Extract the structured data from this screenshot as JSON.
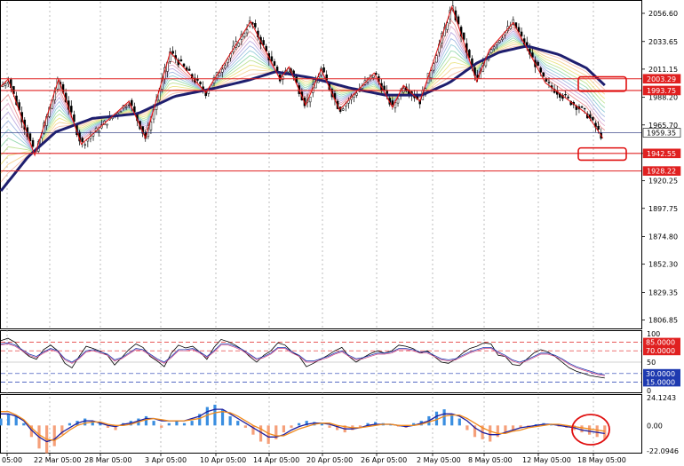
{
  "chart_data": [
    {
      "type": "candlestick",
      "price_axis": {
        "ticks": [
          "2056.60",
          "2033.65",
          "2011.15",
          "1988.20",
          "1965.70",
          "1942.55",
          "1920.25",
          "1897.75",
          "1874.80",
          "1852.30",
          "1829.35",
          "1806.85"
        ],
        "range": [
          1800,
          2066
        ]
      },
      "time_axis_labels": [
        "05:00",
        "22 Mar 05:00",
        "28 Mar 05:00",
        "3 Apr 05:00",
        "10 Apr 05:00",
        "14 Apr 05:00",
        "20 Apr 05:00",
        "26 Apr 05:00",
        "2 May 05:00",
        "8 May 05:00",
        "12 May 05:00",
        "18 May 05:00"
      ],
      "horizontal_levels": [
        {
          "label": "2003.29",
          "value": 2003.29,
          "color": "#e02020"
        },
        {
          "label": "1993.75",
          "value": 1993.75,
          "color": "#e02020"
        },
        {
          "label": "1959.35",
          "value": 1959.35,
          "color": "#1e2a78"
        },
        {
          "label": "1942.55",
          "value": 1942.55,
          "color": "#e02020"
        },
        {
          "label": "1928.22",
          "value": 1928.22,
          "color": "#e02020"
        }
      ],
      "current_price": "1959.35",
      "zigzag_points": [
        {
          "t": 0,
          "v": 1997
        },
        {
          "t": 8,
          "v": 2003
        },
        {
          "t": 37,
          "v": 1941
        },
        {
          "t": 63,
          "v": 2003
        },
        {
          "t": 88,
          "v": 1950
        },
        {
          "t": 140,
          "v": 1985
        },
        {
          "t": 158,
          "v": 1955
        },
        {
          "t": 185,
          "v": 2025
        },
        {
          "t": 224,
          "v": 1992
        },
        {
          "t": 273,
          "v": 2050
        },
        {
          "t": 305,
          "v": 2003
        },
        {
          "t": 315,
          "v": 2013
        },
        {
          "t": 333,
          "v": 1982
        },
        {
          "t": 350,
          "v": 2011
        },
        {
          "t": 370,
          "v": 1978
        },
        {
          "t": 408,
          "v": 2008
        },
        {
          "t": 428,
          "v": 1980
        },
        {
          "t": 440,
          "v": 1998
        },
        {
          "t": 458,
          "v": 1985
        },
        {
          "t": 493,
          "v": 2062
        },
        {
          "t": 520,
          "v": 2001
        },
        {
          "t": 534,
          "v": 2027
        },
        {
          "t": 560,
          "v": 2049
        },
        {
          "t": 595,
          "v": 2000
        },
        {
          "t": 640,
          "v": 1975
        },
        {
          "t": 658,
          "v": 1955
        }
      ],
      "moving_average_main": [
        {
          "t": 0,
          "v": 1912
        },
        {
          "t": 30,
          "v": 1940
        },
        {
          "t": 60,
          "v": 1960
        },
        {
          "t": 100,
          "v": 1971
        },
        {
          "t": 150,
          "v": 1975
        },
        {
          "t": 190,
          "v": 1989
        },
        {
          "t": 230,
          "v": 1995
        },
        {
          "t": 270,
          "v": 2002
        },
        {
          "t": 300,
          "v": 2009
        },
        {
          "t": 340,
          "v": 2004
        },
        {
          "t": 380,
          "v": 1996
        },
        {
          "t": 420,
          "v": 1990
        },
        {
          "t": 460,
          "v": 1990
        },
        {
          "t": 490,
          "v": 2000
        },
        {
          "t": 520,
          "v": 2016
        },
        {
          "t": 545,
          "v": 2025
        },
        {
          "t": 575,
          "v": 2030
        },
        {
          "t": 610,
          "v": 2023
        },
        {
          "t": 640,
          "v": 2012
        },
        {
          "t": 660,
          "v": 1998
        }
      ],
      "annotation_boxes": [
        {
          "target": "2003.29-1993.75 zone"
        },
        {
          "target": "1942.55-1928.22 zone"
        }
      ]
    },
    {
      "type": "line",
      "name": "oscillator",
      "axis_labels": [
        "100",
        "85.0000",
        "70.0000",
        "50",
        "30.0000",
        "15.0000",
        "0"
      ],
      "levels": [
        85,
        70,
        50,
        30,
        15
      ],
      "series": [
        {
          "values": [
            88,
            92,
            85,
            70,
            60,
            55,
            72,
            80,
            70,
            48,
            40,
            60,
            78,
            74,
            69,
            62,
            45,
            58,
            72,
            82,
            76,
            60,
            52,
            42,
            66,
            80,
            75,
            78,
            68,
            55,
            76,
            90,
            86,
            80,
            72,
            60,
            50,
            62,
            70,
            84,
            80,
            68,
            60,
            42,
            48,
            55,
            62,
            70,
            76,
            60,
            50,
            58,
            65,
            70,
            66,
            70,
            80,
            78,
            74,
            66,
            70,
            60,
            50,
            48,
            55,
            66,
            74,
            78,
            84,
            82,
            62,
            60,
            46,
            44,
            55,
            66,
            72,
            68,
            60,
            50,
            40,
            34,
            30,
            26,
            24,
            22
          ]
        },
        {
          "values": [
            82,
            84,
            80,
            72,
            64,
            60,
            68,
            74,
            70,
            56,
            50,
            58,
            70,
            72,
            68,
            64,
            54,
            58,
            66,
            74,
            72,
            64,
            56,
            50,
            60,
            72,
            72,
            74,
            68,
            60,
            70,
            82,
            82,
            78,
            72,
            64,
            56,
            60,
            66,
            76,
            76,
            68,
            62,
            52,
            52,
            56,
            60,
            66,
            70,
            62,
            56,
            58,
            62,
            66,
            66,
            68,
            74,
            74,
            72,
            68,
            68,
            62,
            56,
            54,
            56,
            62,
            68,
            72,
            76,
            76,
            68,
            62,
            54,
            50,
            54,
            60,
            66,
            66,
            62,
            56,
            48,
            42,
            38,
            34,
            30,
            28
          ]
        }
      ],
      "marker_labels": [
        "85.0000",
        "70.0000",
        "30.0000",
        "15.0000"
      ]
    },
    {
      "type": "bar",
      "name": "macd",
      "axis_labels": [
        "24.1243",
        "0.00",
        "-22.0946"
      ],
      "histogram": [
        6,
        10,
        8,
        2,
        -10,
        -20,
        -24,
        -18,
        -8,
        2,
        4,
        6,
        4,
        2,
        -2,
        -4,
        2,
        4,
        6,
        8,
        4,
        -2,
        2,
        4,
        2,
        4,
        10,
        16,
        18,
        14,
        8,
        4,
        -2,
        -8,
        -14,
        -16,
        -12,
        -6,
        -2,
        2,
        4,
        3,
        2,
        -2,
        -4,
        -6,
        -4,
        -2,
        2,
        3,
        2,
        1,
        -1,
        -2,
        2,
        4,
        8,
        12,
        14,
        10,
        6,
        -4,
        -10,
        -12,
        -14,
        -10,
        -6,
        -4,
        -2,
        -1,
        1,
        2,
        1,
        -1,
        -2,
        -4,
        -6,
        -8,
        -10,
        -12
      ],
      "signal": [
        10,
        10,
        8,
        4,
        -4,
        -10,
        -14,
        -12,
        -6,
        -2,
        2,
        4,
        4,
        2,
        0,
        -1,
        1,
        2,
        4,
        6,
        6,
        4,
        4,
        4,
        4,
        6,
        8,
        12,
        14,
        14,
        10,
        6,
        2,
        -2,
        -6,
        -10,
        -10,
        -8,
        -4,
        -1,
        1,
        2,
        2,
        1,
        -1,
        -3,
        -3,
        -2,
        0,
        1,
        1,
        1,
        0,
        -1,
        0,
        2,
        4,
        8,
        10,
        10,
        8,
        4,
        -2,
        -6,
        -8,
        -8,
        -6,
        -4,
        -2,
        -1,
        0,
        1,
        1,
        0,
        -1,
        -2,
        -4,
        -5,
        -6,
        -7
      ],
      "ema": [
        12,
        12,
        9,
        5,
        -2,
        -8,
        -12,
        -13,
        -9,
        -4,
        0,
        2,
        3,
        3,
        1,
        0,
        0,
        1,
        3,
        5,
        6,
        5,
        4,
        4,
        4,
        5,
        6,
        9,
        11,
        12,
        11,
        8,
        4,
        0,
        -3,
        -7,
        -9,
        -9,
        -6,
        -3,
        -1,
        1,
        2,
        2,
        0,
        -1,
        -2,
        -2,
        -1,
        0,
        1,
        1,
        0,
        0,
        0,
        1,
        3,
        5,
        8,
        9,
        9,
        6,
        2,
        -2,
        -5,
        -7,
        -7,
        -5,
        -4,
        -2,
        -1,
        0,
        1,
        1,
        0,
        -1,
        -2,
        -3,
        -4,
        -5
      ]
    }
  ]
}
